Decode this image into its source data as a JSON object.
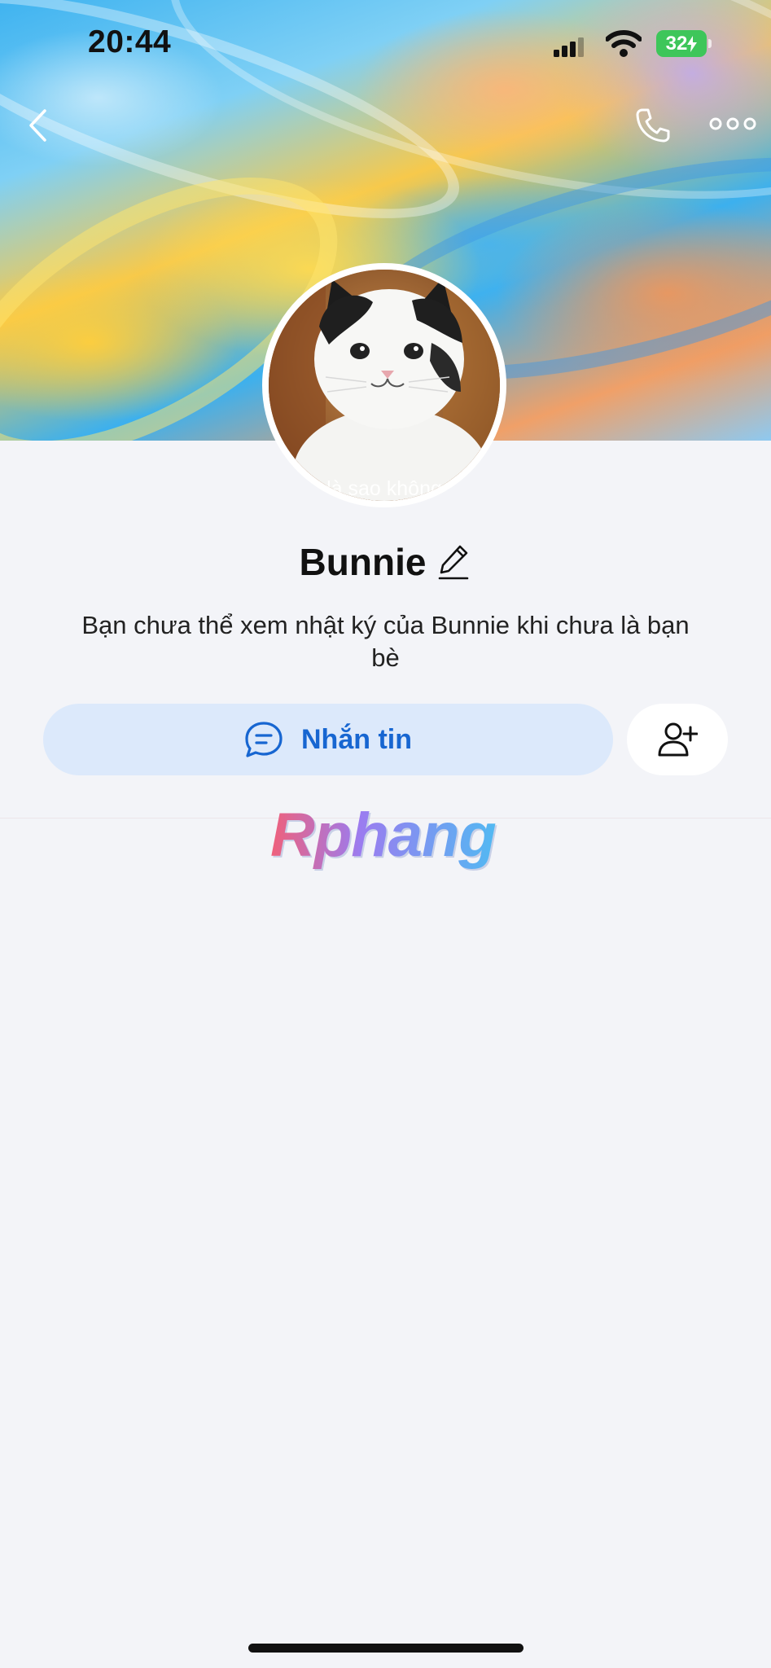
{
  "status_bar": {
    "time": "20:44",
    "battery": "32"
  },
  "header": {
    "back_icon": "chevron-left-icon",
    "call_icon": "phone-icon",
    "more_icon": "more-dots-icon"
  },
  "profile": {
    "avatar_caption": "là sao không",
    "name": "Bunnie",
    "edit_icon": "pencil-icon",
    "notice": "Bạn chưa thể xem nhật ký của Bunnie khi chưa là bạn bè"
  },
  "actions": {
    "message_label": "Nhắn tin",
    "message_icon": "chat-bubble-icon",
    "add_friend_icon": "add-user-icon",
    "message_color": "#1766d1",
    "message_bg": "#dce9fb"
  },
  "watermark": {
    "text": "Rphang"
  }
}
